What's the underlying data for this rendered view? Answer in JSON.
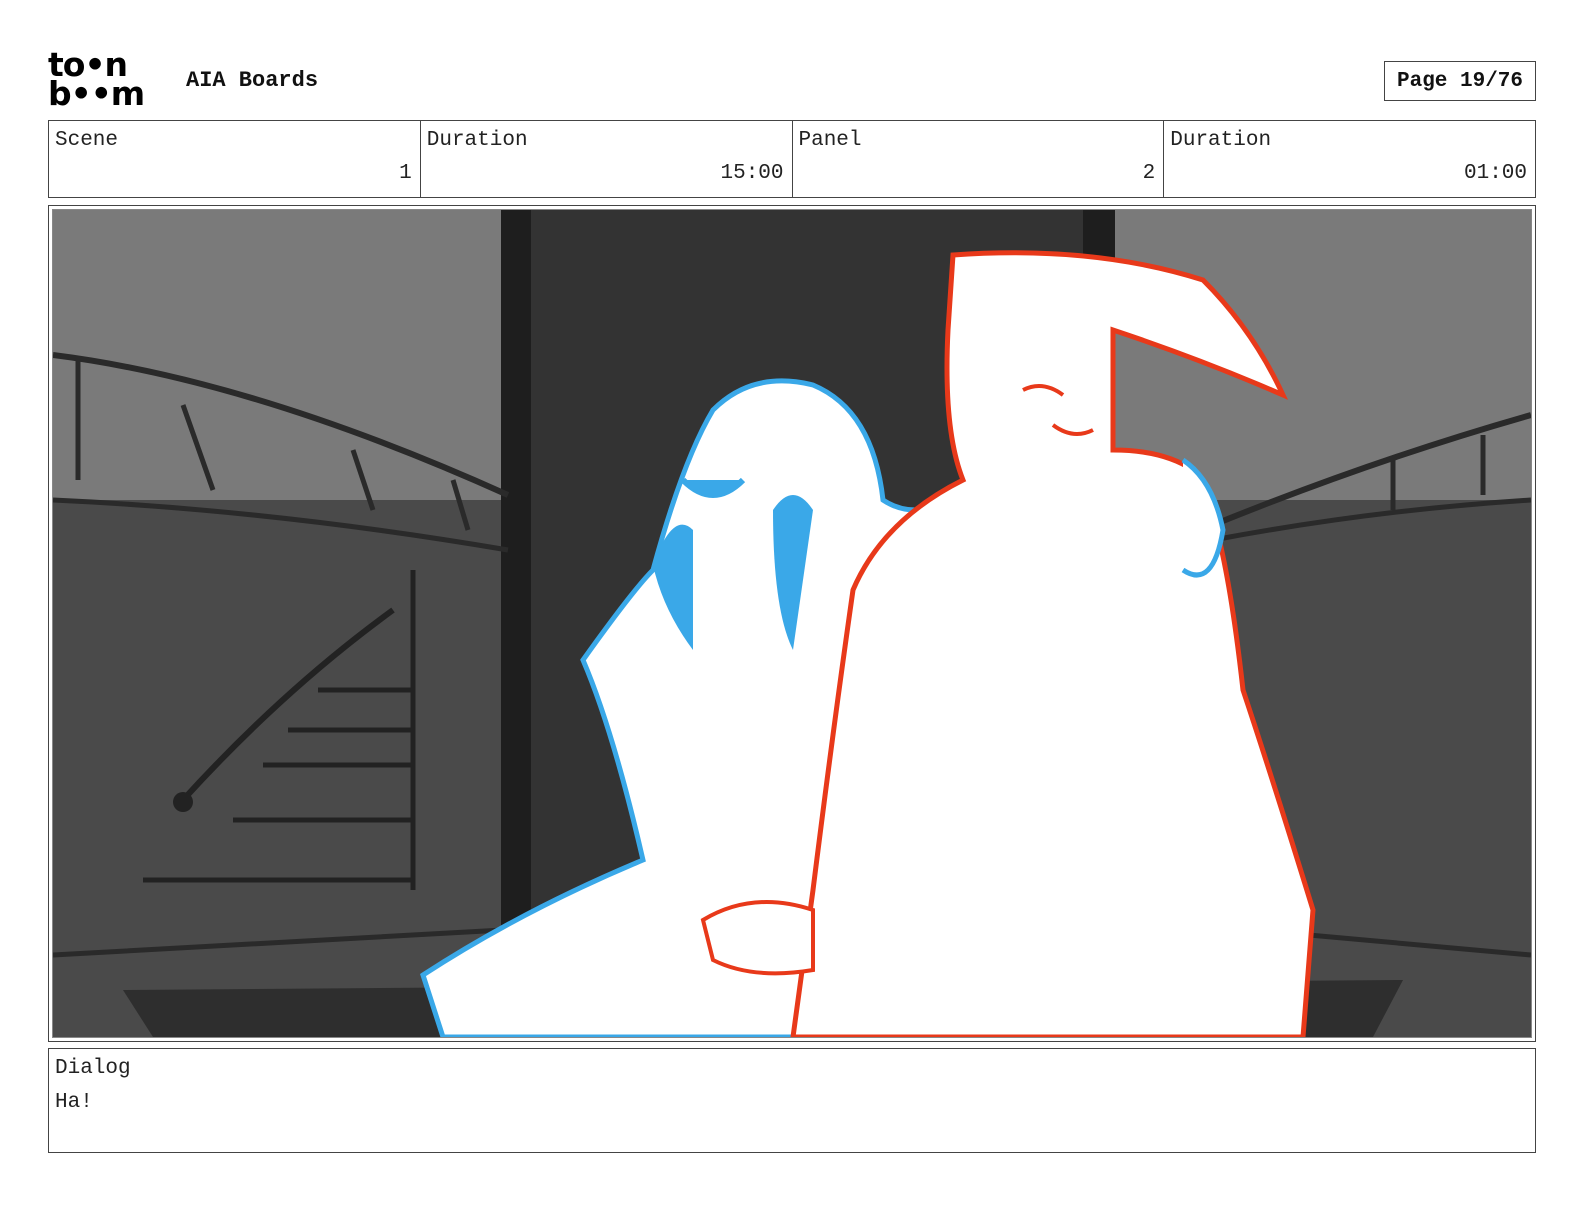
{
  "header": {
    "logo_line1": "to•n",
    "logo_line2": "b••m",
    "project_title": "AIA Boards",
    "page_label": "Page 19/76"
  },
  "info": {
    "scene_label": "Scene",
    "scene_value": "1",
    "scene_duration_label": "Duration",
    "scene_duration_value": "15:00",
    "panel_label": "Panel",
    "panel_value": "2",
    "panel_duration_label": "Duration",
    "panel_duration_value": "01:00"
  },
  "panel": {
    "line_colors": {
      "woman": "#3aa8e8",
      "man": "#e8391a"
    }
  },
  "dialog": {
    "label": "Dialog",
    "text": "Ha!"
  }
}
